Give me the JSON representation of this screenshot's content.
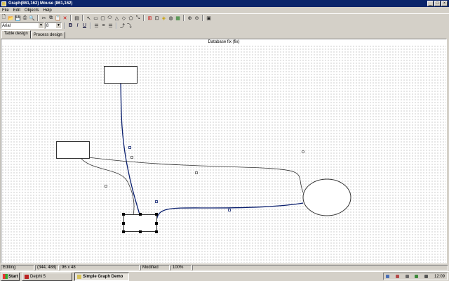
{
  "window": {
    "title": "Graph(861,162) Mouse (861,162)"
  },
  "menu": [
    "File",
    "Edit",
    "Objects",
    "Help"
  ],
  "format_bar": {
    "font": "Arial",
    "size": "8",
    "bold": "B",
    "italic": "I",
    "underline": "U"
  },
  "tabs": [
    {
      "label": "Table design"
    },
    {
      "label": "Process design"
    }
  ],
  "canvas": {
    "title": "Database fix (fix)"
  },
  "status": {
    "mode": "Editing",
    "coords": "(344, 488)",
    "size": "96 x 48",
    "state": "Modified",
    "zoom": "100%"
  },
  "taskbar": {
    "start": "Start",
    "tasks": [
      {
        "label": "Delphi 5"
      },
      {
        "label": "Simple Graph Demo"
      }
    ],
    "clock": "12:09"
  }
}
